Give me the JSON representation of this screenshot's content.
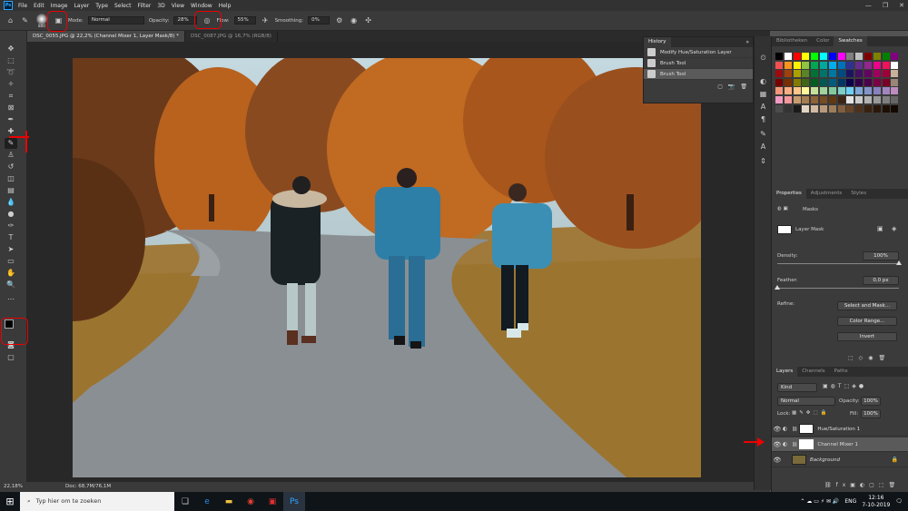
{
  "menubar": {
    "logo": "Ps",
    "items": [
      "File",
      "Edit",
      "Image",
      "Layer",
      "Type",
      "Select",
      "Filter",
      "3D",
      "View",
      "Window",
      "Help"
    ],
    "window_buttons": [
      "—",
      "❐",
      "✕"
    ]
  },
  "options": {
    "brush_size": "800",
    "mode_label": "Mode:",
    "mode_value": "Normal",
    "opacity_label": "Opacity:",
    "opacity_value": "28%",
    "flow_label": "Flow:",
    "flow_value": "55%",
    "smoothing_label": "Smoothing:",
    "smoothing_value": "0%"
  },
  "tabs": [
    {
      "label": "DSC_0055.JPG @ 22,2% (Channel Mixer 1, Layer Mask/8) *"
    },
    {
      "label": "DSC_0087.JPG @ 16,7% (RGB/8)"
    }
  ],
  "status": {
    "zoom": "22,18%",
    "doc": "Doc: 68,7M/76,1M"
  },
  "history": {
    "tab": "History",
    "items": [
      {
        "label": "Modify Hue/Saturation Layer"
      },
      {
        "label": "Brush Tool"
      },
      {
        "label": "Brush Tool"
      }
    ]
  },
  "swatches_panel": {
    "tabs": [
      "Bibliotheken",
      "Color",
      "Swatches"
    ],
    "colors": [
      "#000000",
      "#ffffff",
      "#ff0000",
      "#ffff00",
      "#00ff00",
      "#00ffff",
      "#0000ff",
      "#ff00ff",
      "#808080",
      "#c0c0c0",
      "#800000",
      "#808000",
      "#008000",
      "#800080",
      "#f25050",
      "#f7941d",
      "#fff200",
      "#8dc63f",
      "#00a651",
      "#00a99d",
      "#00aeef",
      "#0072bc",
      "#2e3192",
      "#662d91",
      "#92278f",
      "#ec008c",
      "#ed145b",
      "#ffffff",
      "#9e0b0f",
      "#a0410d",
      "#aba000",
      "#598527",
      "#007236",
      "#00746b",
      "#0076a3",
      "#004a80",
      "#1b1464",
      "#440e62",
      "#630460",
      "#9e005d",
      "#9e0039",
      "#c7b299",
      "#790000",
      "#7b2e00",
      "#827b00",
      "#406618",
      "#005e20",
      "#005952",
      "#005b7f",
      "#003663",
      "#0d004c",
      "#32004b",
      "#4b0049",
      "#7b0046",
      "#7a0026",
      "#998675",
      "#f69679",
      "#f9ad81",
      "#fdc689",
      "#fff799",
      "#c4df9b",
      "#a3d39c",
      "#82ca9d",
      "#7bcdc8",
      "#6dcff6",
      "#7da7d9",
      "#8393ca",
      "#8781bd",
      "#a186be",
      "#bd8cbf",
      "#f49ac2",
      "#f5989d",
      "#c69c6d",
      "#a67c52",
      "#8c6239",
      "#754c24",
      "#603913",
      "#3c2415",
      "#e5e5e5",
      "#cccccc",
      "#b2b2b2",
      "#999999",
      "#7f7f7f",
      "#666666",
      "#4c4c4c",
      "#333333",
      "#1a1a1a",
      "#e3d5c3",
      "#d1bba2",
      "#b89a7b",
      "#9d7c5a",
      "#825f3f",
      "#674528",
      "#4e311a",
      "#392110",
      "#2a1709",
      "#1d0f04",
      "#130800"
    ]
  },
  "properties": {
    "tabs": [
      "Properties",
      "Adjustments",
      "Styles"
    ],
    "section": "Masks",
    "layer_mask": "Layer Mask",
    "density_label": "Density:",
    "density_value": "100%",
    "density": 1.0,
    "feather_label": "Feather:",
    "feather_value": "0,0 px",
    "feather": 0.0,
    "refine_label": "Refine:",
    "btn_select_mask": "Select and Mask...",
    "btn_color_range": "Color Range...",
    "btn_invert": "Invert"
  },
  "layers": {
    "tabs": [
      "Layers",
      "Channels",
      "Paths"
    ],
    "kind": "Kind",
    "blend": "Normal",
    "opacity_label": "Opacity:",
    "opacity_value": "100%",
    "lock_label": "Lock:",
    "fill_label": "Fill:",
    "fill_value": "100%",
    "rows": [
      {
        "name": "Hue/Saturation 1"
      },
      {
        "name": "Channel Mixer 1"
      },
      {
        "name": "Background"
      }
    ]
  },
  "taskbar": {
    "search_placeholder": "Typ hier om te zoeken",
    "lang": "ENG",
    "time": "12:16",
    "date": "7-10-2019"
  },
  "colors": {
    "accent_red": "#e00000",
    "ps_blue": "#31a8ff"
  }
}
